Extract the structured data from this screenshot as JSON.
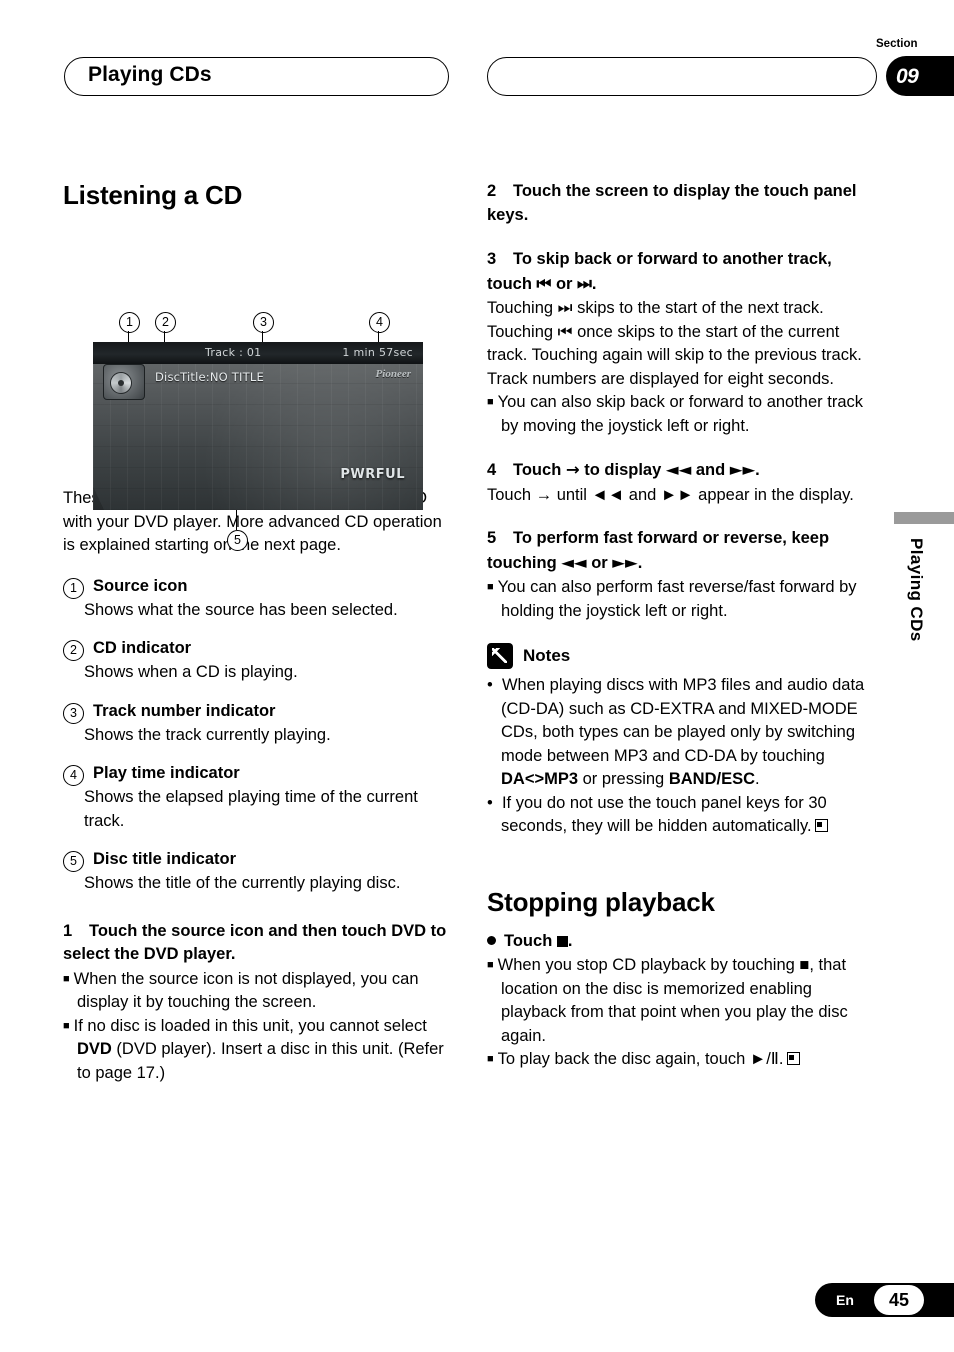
{
  "header": {
    "left_title": "Playing CDs",
    "section_label": "Section",
    "section_number": "09"
  },
  "side_tab": {
    "text": "Playing CDs"
  },
  "left_column": {
    "title": "Listening a CD",
    "figure": {
      "callouts": [
        "1",
        "2",
        "3",
        "4",
        "5"
      ],
      "screen": {
        "track_label": "Track : 01",
        "play_time": "1 min 57sec",
        "disc_title": "DiscTitle:NO TITLE",
        "brand": "Pioneer",
        "sound_mode": "PWRFUL"
      }
    },
    "intro": "These are the basic steps necessary to play a CD with your DVD player. More advanced CD operation is explained starting on the next page.",
    "items": [
      {
        "num": "1",
        "head": "Source icon",
        "desc": "Shows what the source has been selected."
      },
      {
        "num": "2",
        "head": "CD indicator",
        "desc": "Shows when a CD is playing."
      },
      {
        "num": "3",
        "head": "Track number indicator",
        "desc": "Shows the track currently playing."
      },
      {
        "num": "4",
        "head": "Play time indicator",
        "desc": "Shows the elapsed playing time of the current track."
      },
      {
        "num": "5",
        "head": "Disc title indicator",
        "desc": "Shows the title of the currently playing disc."
      }
    ],
    "step1": {
      "num": "1",
      "head": "Touch the source icon and then touch DVD to select the DVD player.",
      "bullets": [
        "When the source icon is not displayed, you can display it by touching the screen.",
        "If no disc is loaded in this unit, you cannot select DVD (DVD player). Insert a disc in this unit. (Refer to page 17.)"
      ],
      "bullet2_parts": {
        "a": "If no disc is loaded in this unit, you cannot select ",
        "bold": "DVD",
        "b": " (DVD player). Insert a disc in this unit. (Refer to page 17.)"
      }
    }
  },
  "right_column": {
    "step2": {
      "num": "2",
      "head": "Touch the screen to display the touch panel keys."
    },
    "step3": {
      "num": "3",
      "head_a": "To skip back or forward to another track, touch ",
      "head_icon1": "⏮",
      "head_mid": " or ",
      "head_icon2": "⏭",
      "head_b": ".",
      "body": "Touching ⏭ skips to the start of the next track. Touching ⏮ once skips to the start of the current track. Touching again will skip to the previous track.",
      "body2": "Track numbers are displayed for eight seconds.",
      "bullet": "You can also skip back or forward to another track by moving the joystick left or right."
    },
    "step4": {
      "num": "4",
      "head_a": "Touch ",
      "head_arrow": "→",
      "head_b": " to display ",
      "head_icon1": "◄◄",
      "head_mid": " and ",
      "head_icon2": "►►",
      "head_c": ".",
      "body": "Touch → until ◄◄ and ►► appear in the display."
    },
    "step5": {
      "num": "5",
      "head_a": "To perform fast forward or reverse, keep touching ",
      "head_icon1": "◄◄",
      "head_mid": " or ",
      "head_icon2": "►►",
      "head_b": ".",
      "bullet": "You can also perform fast reverse/fast forward by holding the joystick left or right."
    },
    "notes": {
      "title": "Notes",
      "items": [
        {
          "a": "When playing discs with MP3 files and audio data (CD-DA) such as CD-EXTRA and MIXED-MODE CDs, both types can be played only by switching mode between MP3 and CD-DA by touching ",
          "bold1": "DA<>MP3",
          "b": " or pressing ",
          "bold2": "BAND/ESC",
          "c": "."
        },
        {
          "a": "If you do not use the touch panel keys for 30 seconds, they will be hidden automatically.",
          "bold1": "",
          "b": "",
          "bold2": "",
          "c": ""
        }
      ]
    },
    "stopping": {
      "title": "Stopping playback",
      "touch_label": "Touch ",
      "bullets": [
        "When you stop CD playback by touching ■, that location on the disc is memorized enabling playback from that point when you play the disc again.",
        "To play back the disc again, touch ►/Ⅱ."
      ]
    }
  },
  "footer": {
    "language": "En",
    "page_number": "45"
  }
}
